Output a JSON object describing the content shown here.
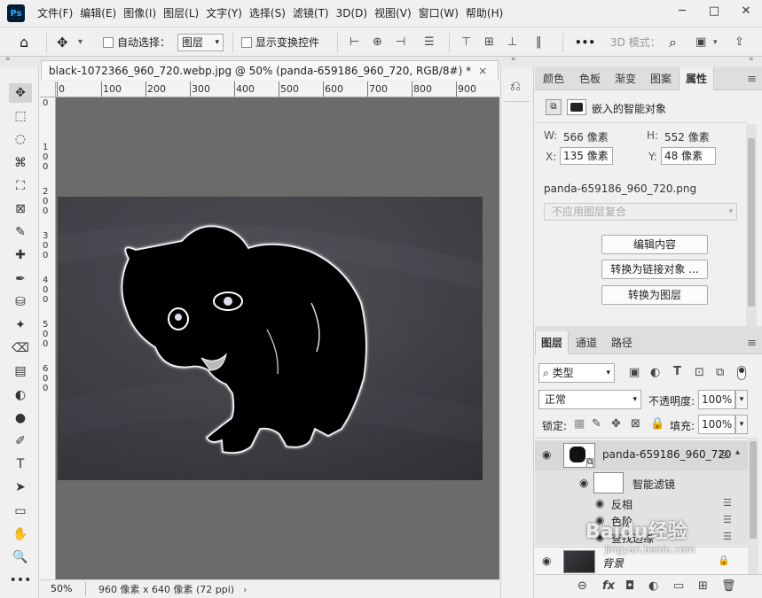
{
  "app": {
    "logo": "Ps"
  },
  "menu": [
    "文件(F)",
    "编辑(E)",
    "图像(I)",
    "图层(L)",
    "文字(Y)",
    "选择(S)",
    "滤镜(T)",
    "3D(D)",
    "视图(V)",
    "窗口(W)",
    "帮助(H)"
  ],
  "window_buttons": {
    "minimize": "─",
    "maximize": "□",
    "close": "✕"
  },
  "options": {
    "home_icon": "⌂",
    "move_icon": "✥",
    "auto_select_label": "自动选择：",
    "auto_select_value": "图层",
    "show_transform_label": "显示变换控件",
    "more": "•••",
    "mode3d_label": "3D 模式：",
    "search_icon": "⌕"
  },
  "document": {
    "tab_title": "black-1072366_960_720.webp.jpg @ 50% (panda-659186_960_720, RGB/8#) *",
    "tab_close": "×",
    "ruler_h": [
      "0",
      "100",
      "200",
      "300",
      "400",
      "500",
      "600",
      "700",
      "800",
      "900"
    ],
    "ruler_v": [
      "0",
      "100",
      "200",
      "300",
      "400",
      "500",
      "600"
    ],
    "zoom": "50%",
    "info": "960 像素 x 640 像素 (72 ppi)",
    "info_arrow": "›"
  },
  "tools": [
    "✥",
    "⬚",
    "◌",
    "⌘",
    "⛶",
    "⊠",
    "✎",
    "✚",
    "✒",
    "⛁",
    "✦",
    "⌫",
    "▤",
    "◐",
    "●",
    "✐",
    "T",
    "➤",
    "▭",
    "✋",
    "🔍",
    "•••"
  ],
  "props_tabs": [
    "颜色",
    "色板",
    "渐变",
    "图案",
    "属性"
  ],
  "props": {
    "title": "嵌入的智能对象",
    "w_label": "W:",
    "w_value": "566 像素",
    "h_label": "H:",
    "h_value": "552 像素",
    "x_label": "X:",
    "x_value": "135 像素",
    "y_label": "Y:",
    "y_value": "48 像素",
    "filename": "panda-659186_960_720.png",
    "comp_placeholder": "不应用图层复合",
    "btn_edit": "编辑内容",
    "btn_link": "转换为链接对象 ...",
    "btn_layer": "转换为图层"
  },
  "layers_tabs": [
    "图层",
    "通道",
    "路径"
  ],
  "layers": {
    "filter_type": "类型",
    "blend_mode": "正常",
    "opacity_label": "不透明度:",
    "opacity_value": "100%",
    "lock_label": "锁定:",
    "fill_label": "填充:",
    "fill_value": "100%",
    "items": [
      {
        "name": "panda-659186_960_720"
      },
      {
        "name": "智能滤镜"
      },
      {
        "name": "反相"
      },
      {
        "name": "色阶"
      },
      {
        "name": "查找边缘"
      },
      {
        "name": "背景"
      }
    ],
    "footer_icons": [
      "⊖",
      "fx",
      "◘",
      "◐",
      "▭",
      "⊞",
      "🗑"
    ]
  },
  "watermark": {
    "text": "Baidu经验",
    "url": "jingyan.baidu.com"
  }
}
